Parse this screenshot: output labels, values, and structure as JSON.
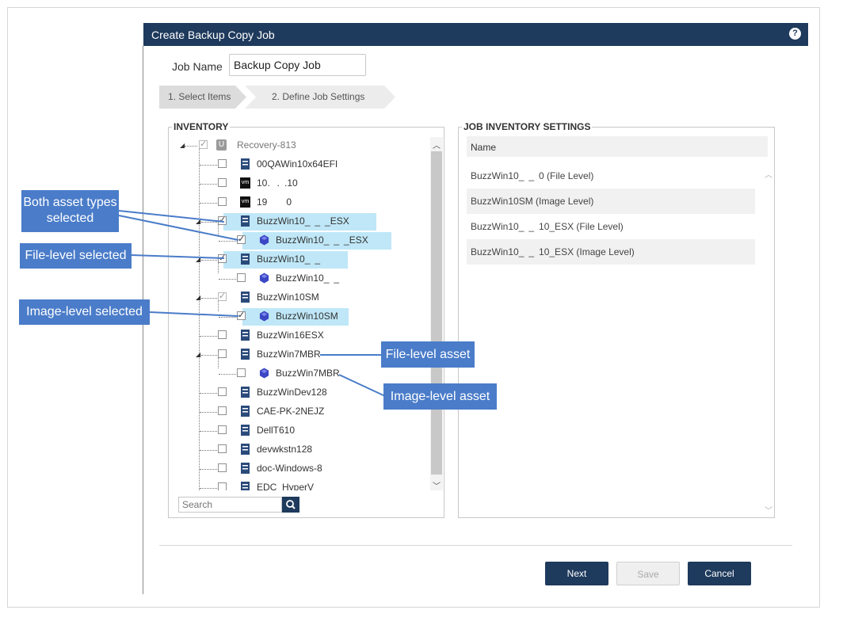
{
  "dialog": {
    "title": "Create Backup Copy Job",
    "help_icon": "help-icon",
    "job_name_label": "Job Name",
    "job_name_value": "Backup Copy Job",
    "steps": [
      "1. Select Items",
      "2. Define Job Settings"
    ]
  },
  "inventory": {
    "legend": "INVENTORY",
    "root": "Recovery-813",
    "items": [
      {
        "label": "00QAWin10x64EFI",
        "icon": "server-icon"
      },
      {
        "label": "10.   .  .10",
        "icon": "vmware-icon"
      },
      {
        "label": "19        0",
        "icon": "vmware-icon"
      },
      {
        "label": "BuzzWin10_  _  _ESX",
        "icon": "server-icon"
      },
      {
        "label": "BuzzWin10_  _  _ESX",
        "icon": "image-icon"
      },
      {
        "label": "BuzzWin10_  _  ",
        "icon": "server-icon"
      },
      {
        "label": "BuzzWin10_  _  ",
        "icon": "image-icon"
      },
      {
        "label": "BuzzWin10SM",
        "icon": "server-icon"
      },
      {
        "label": "BuzzWin10SM",
        "icon": "image-icon"
      },
      {
        "label": "BuzzWin16ESX",
        "icon": "server-icon"
      },
      {
        "label": "BuzzWin7MBR",
        "icon": "server-icon"
      },
      {
        "label": "BuzzWin7MBR",
        "icon": "image-icon"
      },
      {
        "label": "BuzzWinDev128",
        "icon": "server-icon"
      },
      {
        "label": "CAE-PK-2NEJZ",
        "icon": "server-icon"
      },
      {
        "label": "DellT610",
        "icon": "server-icon"
      },
      {
        "label": "devwkstn128",
        "icon": "server-icon"
      },
      {
        "label": "doc-Windows-8",
        "icon": "server-icon"
      },
      {
        "label": "EDC_HyperV",
        "icon": "server-icon"
      }
    ],
    "search_placeholder": "Search"
  },
  "settings": {
    "legend": "JOB INVENTORY SETTINGS",
    "column": "Name",
    "rows": [
      "BuzzWin10_  _  0 (File Level)",
      "BuzzWin10SM (Image Level)",
      "BuzzWin10_  _  10_ESX (File Level)",
      "BuzzWin10_  _  10_ESX (Image Level)"
    ]
  },
  "buttons": {
    "next": "Next",
    "save": "Save",
    "cancel": "Cancel"
  },
  "callouts": {
    "both": "Both asset types selected",
    "file_sel": "File-level selected",
    "image_sel": "Image-level selected",
    "file_asset": "File-level asset",
    "image_asset": "Image-level asset"
  },
  "colors": {
    "titlebar": "#1e3a5c",
    "highlight": "#bfe7f7",
    "callout": "#4a7cc9"
  }
}
